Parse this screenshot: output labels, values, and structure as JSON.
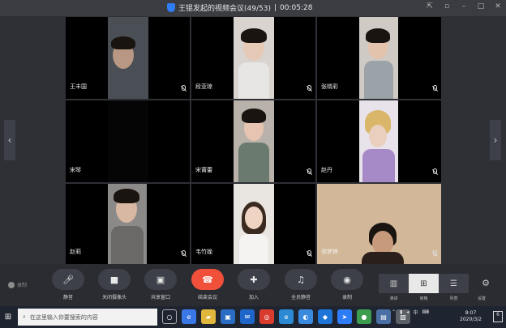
{
  "window": {
    "title": "王锟发起的视频会议(49/53)",
    "separator": "|",
    "timer": "00:05:28"
  },
  "participants": [
    {
      "name": "王丰国"
    },
    {
      "name": "段亚琼"
    },
    {
      "name": "张晓彩"
    },
    {
      "name": "宋琴"
    },
    {
      "name": "宋莆蕾"
    },
    {
      "name": "赵丹"
    },
    {
      "name": "赵莉"
    },
    {
      "name": "韦竹娩"
    },
    {
      "name": "郑梦婷"
    }
  ],
  "toolbar": {
    "recording": "录制",
    "mute": "静音",
    "camera_off": "关闭摄像头",
    "share_window": "共享窗口",
    "end_meeting": "结束会议",
    "join": "加入",
    "mute_all": "全员静音",
    "record": "录制",
    "views": [
      "演讲",
      "宫格",
      "列表"
    ],
    "settings": "设置"
  },
  "taskbar": {
    "search_placeholder": "在这里输入你要搜索的内容",
    "ime": "中",
    "time": "8:07",
    "date": "2020/3/2",
    "notifications": "6"
  }
}
